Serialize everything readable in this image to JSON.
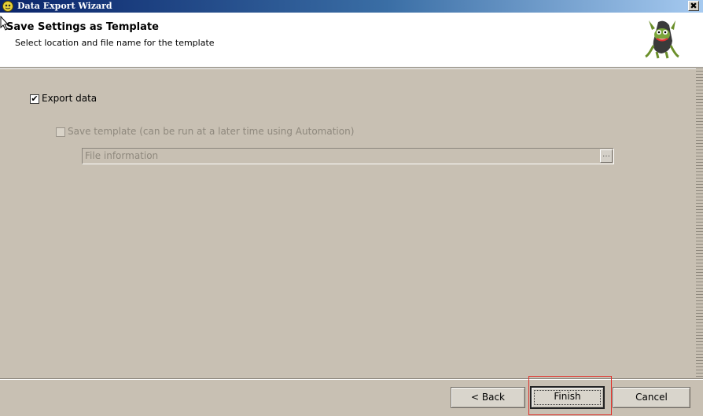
{
  "window": {
    "title": "Data Export Wizard",
    "close_glyph": "✖",
    "app_icon": "frog-app-icon"
  },
  "header": {
    "title": "Save Settings as Template",
    "subtitle": "Select location and file name for the template",
    "image": "frog-mascot-image"
  },
  "options": {
    "export_data": {
      "label": "Export data",
      "checked": true,
      "check_glyph": "✔"
    },
    "save_template": {
      "label": "Save template (can be run at a later time using Automation)",
      "checked": false,
      "enabled": false
    },
    "file_information": {
      "placeholder": "File information",
      "browse_glyph": "…",
      "enabled": false
    }
  },
  "buttons": {
    "back": "< Back",
    "finish": "Finish",
    "cancel": "Cancel"
  },
  "colors": {
    "titlebar_start": "#0a246a",
    "background": "#c8c0b3",
    "highlight": "#e0302a"
  }
}
